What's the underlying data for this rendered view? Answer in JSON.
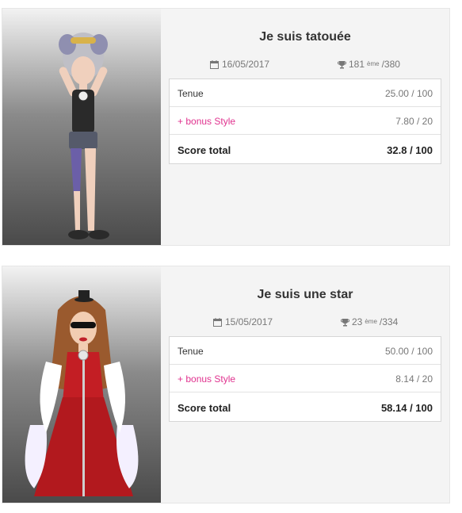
{
  "entries": [
    {
      "title": "Je suis tatouée",
      "date": "16/05/2017",
      "rank": "181",
      "rank_suffix": "ème",
      "rank_total": "/380",
      "rows": [
        {
          "label": "Tenue",
          "value": "25.00 / 100"
        },
        {
          "label": "+ bonus Style",
          "value": "7.80 / 20"
        },
        {
          "label": "Score total",
          "value": "32.8 / 100"
        }
      ]
    },
    {
      "title": "Je suis une star",
      "date": "15/05/2017",
      "rank": "23",
      "rank_suffix": "ème",
      "rank_total": "/334",
      "rows": [
        {
          "label": "Tenue",
          "value": "50.00 / 100"
        },
        {
          "label": "+ bonus Style",
          "value": "8.14 / 20"
        },
        {
          "label": "Score total",
          "value": "58.14 / 100"
        }
      ]
    }
  ],
  "colors": {
    "bonus": "#e0338f",
    "card_bg": "#f4f4f4"
  },
  "icons": {
    "date": "calendar-icon",
    "rank": "trophy-icon"
  }
}
